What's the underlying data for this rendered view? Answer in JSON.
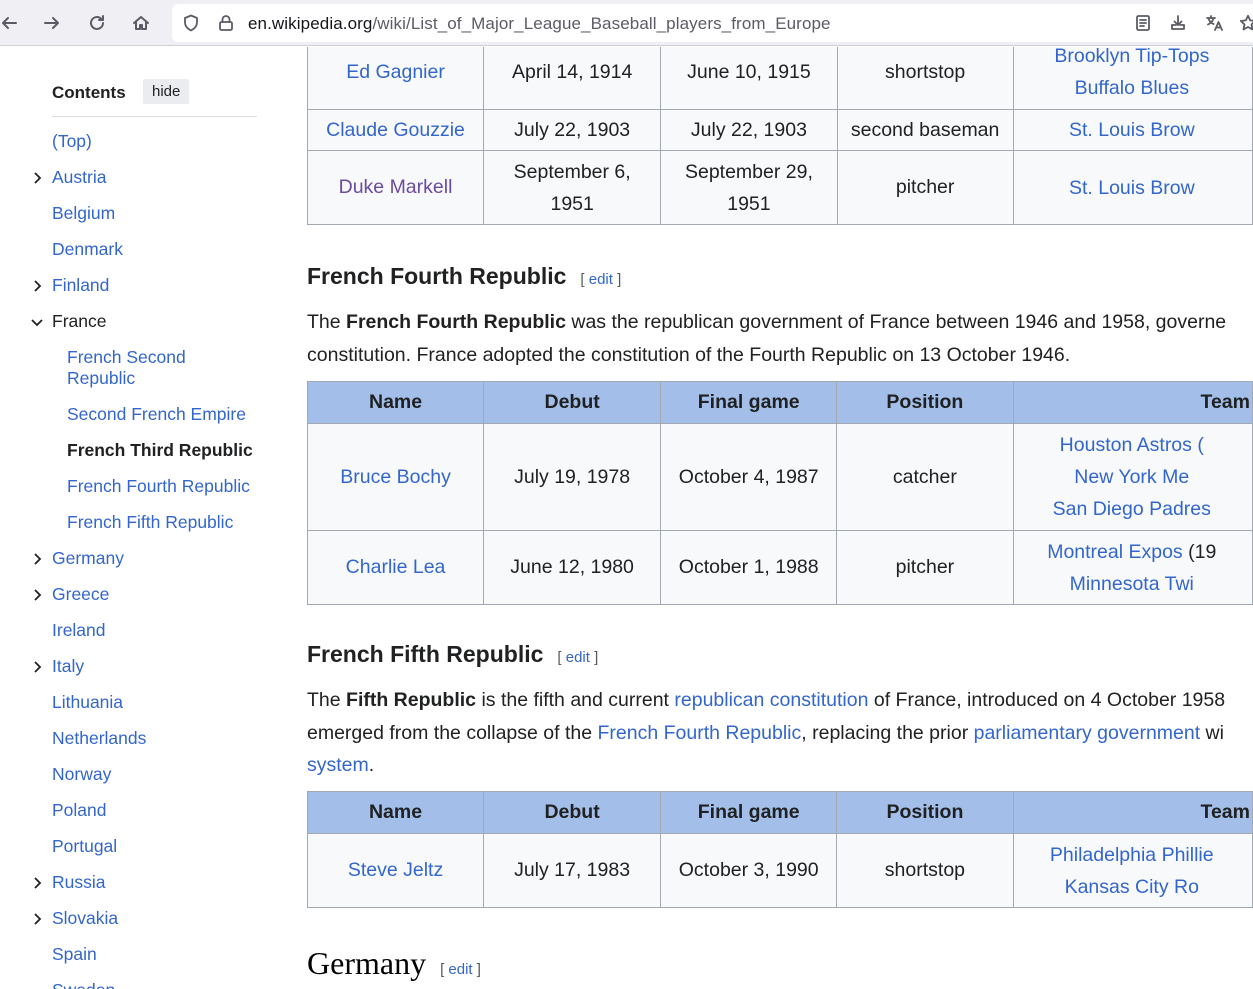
{
  "browser": {
    "url_host": "en.wikipedia.org",
    "url_path": "/wiki/List_of_Major_League_Baseball_players_from_Europe",
    "icons": [
      "back-icon",
      "forward-icon",
      "reload-icon",
      "home-icon",
      "shield-icon",
      "lock-icon",
      "reader-view-icon",
      "download-icon",
      "translate-icon",
      "bookmark-star-icon"
    ]
  },
  "toc": {
    "title": "Contents",
    "hide_label": "hide",
    "items": [
      {
        "label": "(Top)",
        "expandable": false
      },
      {
        "label": "Austria",
        "expandable": true
      },
      {
        "label": "Belgium",
        "expandable": false
      },
      {
        "label": "Denmark",
        "expandable": false
      },
      {
        "label": "Finland",
        "expandable": true
      },
      {
        "label": "France",
        "expandable": true,
        "expanded": true
      },
      {
        "label": "Germany",
        "expandable": true
      },
      {
        "label": "Greece",
        "expandable": true
      },
      {
        "label": "Ireland",
        "expandable": false
      },
      {
        "label": "Italy",
        "expandable": true
      },
      {
        "label": "Lithuania",
        "expandable": false
      },
      {
        "label": "Netherlands",
        "expandable": false
      },
      {
        "label": "Norway",
        "expandable": false
      },
      {
        "label": "Poland",
        "expandable": false
      },
      {
        "label": "Portugal",
        "expandable": false
      },
      {
        "label": "Russia",
        "expandable": true
      },
      {
        "label": "Slovakia",
        "expandable": true
      },
      {
        "label": "Spain",
        "expandable": false
      },
      {
        "label": "Sweden",
        "expandable": false
      }
    ],
    "france_sub": [
      {
        "label_line1": "French Second",
        "label_line2": "Republic"
      },
      {
        "label": "Second French Empire"
      },
      {
        "label": "French Third Republic",
        "active": true
      },
      {
        "label": "French Fourth Republic"
      },
      {
        "label": "French Fifth Republic"
      }
    ]
  },
  "table_top": {
    "rows": [
      {
        "name": "Ed Gagnier",
        "debut": "April 14, 1914",
        "final": "June 10, 1915",
        "position": "shortstop",
        "teams": [
          "Brooklyn Tip-Tops",
          "Buffalo Blues"
        ]
      },
      {
        "name": "Claude Gouzzie",
        "debut": "July 22, 1903",
        "final": "July 22, 1903",
        "position": "second baseman",
        "teams": [
          "St. Louis Brow"
        ]
      },
      {
        "name": "Duke Markell",
        "debut_l1": "September 6,",
        "debut_l2": "1951",
        "final_l1": "September 29,",
        "final_l2": "1951",
        "position": "pitcher",
        "teams": [
          "St. Louis Brow"
        ]
      }
    ]
  },
  "fourth": {
    "heading": "French Fourth Republic",
    "edit": "edit",
    "para_pre": "The ",
    "para_bold": "French Fourth Republic",
    "para_post": " was the republican government of France between 1946 and 1958, governe",
    "para_line2": "constitution. France adopted the constitution of the Fourth Republic on 13 October 1946.",
    "headers": {
      "name": "Name",
      "debut": "Debut",
      "final": "Final game",
      "position": "Position",
      "team": "Team"
    },
    "rows": [
      {
        "name": "Bruce Bochy",
        "debut": "July 19, 1978",
        "final": "October 4, 1987",
        "position": "catcher",
        "teams": [
          "Houston Astros (",
          "New York Me",
          "San Diego Padres"
        ]
      },
      {
        "name": "Charlie Lea",
        "debut": "June 12, 1980",
        "final": "October 1, 1988",
        "position": "pitcher",
        "teams": [
          "Montreal Expos",
          "Minnesota Twi"
        ],
        "team1_suffix": " (19"
      }
    ]
  },
  "fifth": {
    "heading": "French Fifth Republic",
    "edit": "edit",
    "p_a": "The ",
    "p_b": "Fifth Republic",
    "p_c": " is the fifth and current ",
    "p_link1": "republican constitution",
    "p_d": " of France, introduced on 4 October 1958",
    "p_e": "emerged from the collapse of the ",
    "p_link2": "French Fourth Republic",
    "p_f": ", replacing the prior ",
    "p_link3": "parliamentary government",
    "p_g": " wi",
    "p_link4": "system",
    "p_h": ".",
    "headers": {
      "name": "Name",
      "debut": "Debut",
      "final": "Final game",
      "position": "Position",
      "team": "Team"
    },
    "rows": [
      {
        "name": "Steve Jeltz",
        "debut": "July 17, 1983",
        "final": "October 3, 1990",
        "position": "shortstop",
        "teams": [
          "Philadelphia Phillie",
          "Kansas City Ro"
        ]
      }
    ]
  },
  "germany": {
    "heading": "Germany",
    "edit": "edit"
  }
}
